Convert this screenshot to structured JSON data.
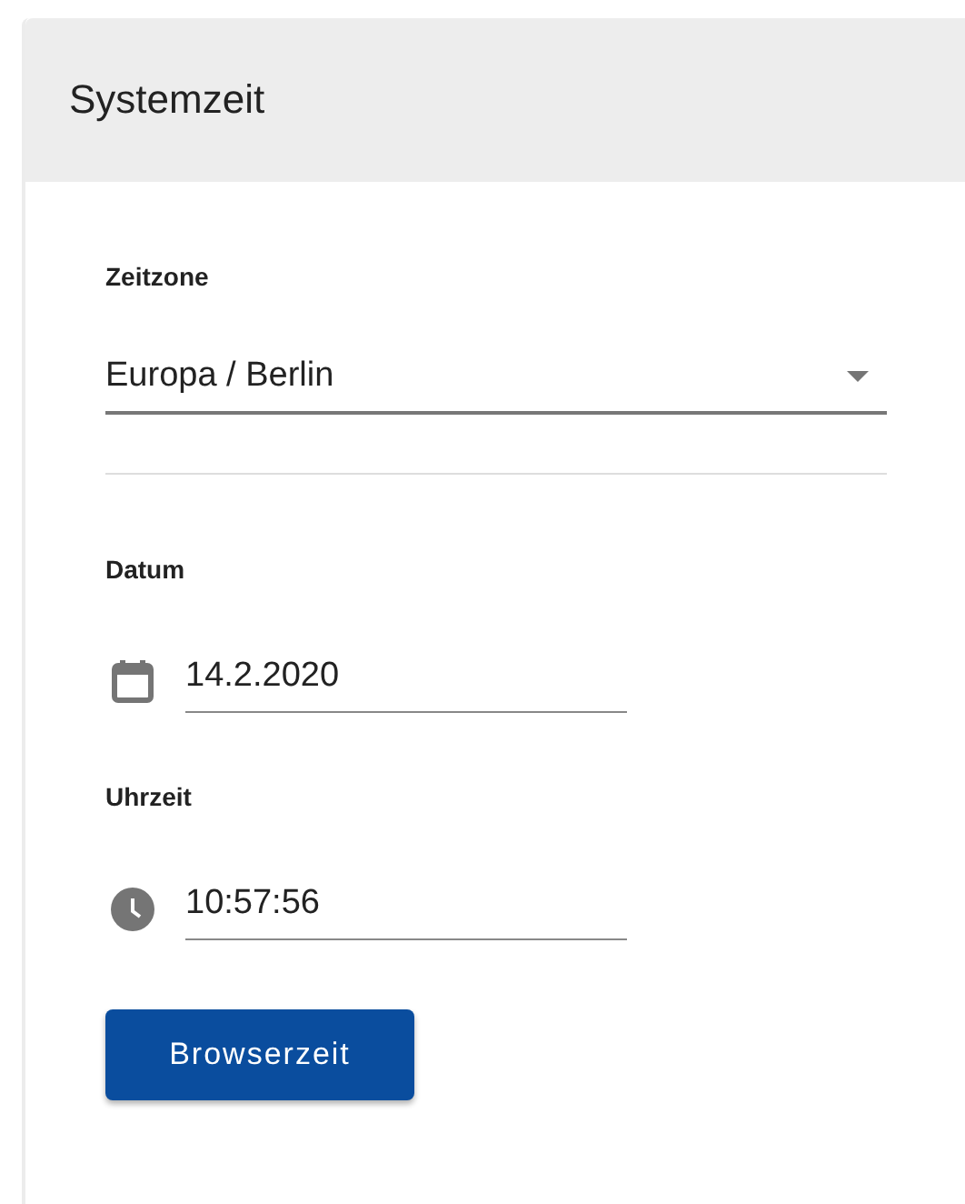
{
  "card": {
    "title": "Systemzeit"
  },
  "timezone": {
    "label": "Zeitzone",
    "value": "Europa / Berlin"
  },
  "date": {
    "label": "Datum",
    "value": "14.2.2020"
  },
  "time": {
    "label": "Uhrzeit",
    "value": "10:57:56"
  },
  "buttons": [
    "Browserzeit"
  ]
}
